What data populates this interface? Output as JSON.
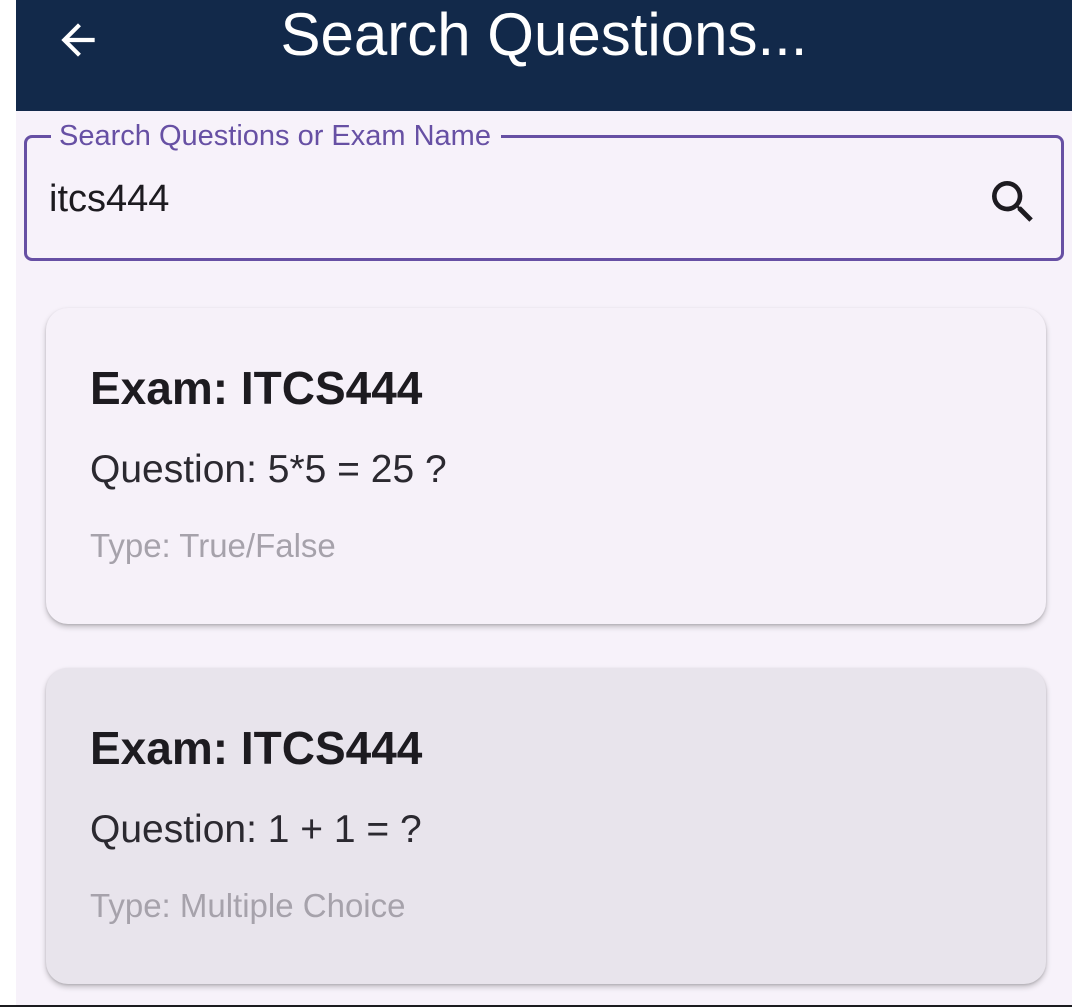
{
  "colors": {
    "appbar_bg": "#12294a",
    "page_bg": "#f7f2fa",
    "accent": "#6750a4",
    "card_bg": "#f6f1f9",
    "card_pressed_bg": "#e8e4ec"
  },
  "appbar": {
    "back_icon": "arrow-left-icon",
    "title": "Search Questions..."
  },
  "search": {
    "label": "Search Questions or Exam Name",
    "value": "itcs444",
    "icon": "search-icon"
  },
  "results": [
    {
      "exam": "Exam: ITCS444",
      "question": "Question: 5*5 = 25 ?",
      "type": "Type: True/False"
    },
    {
      "exam": "Exam: ITCS444",
      "question": "Question: 1 + 1 = ?",
      "type": "Type: Multiple Choice"
    }
  ]
}
